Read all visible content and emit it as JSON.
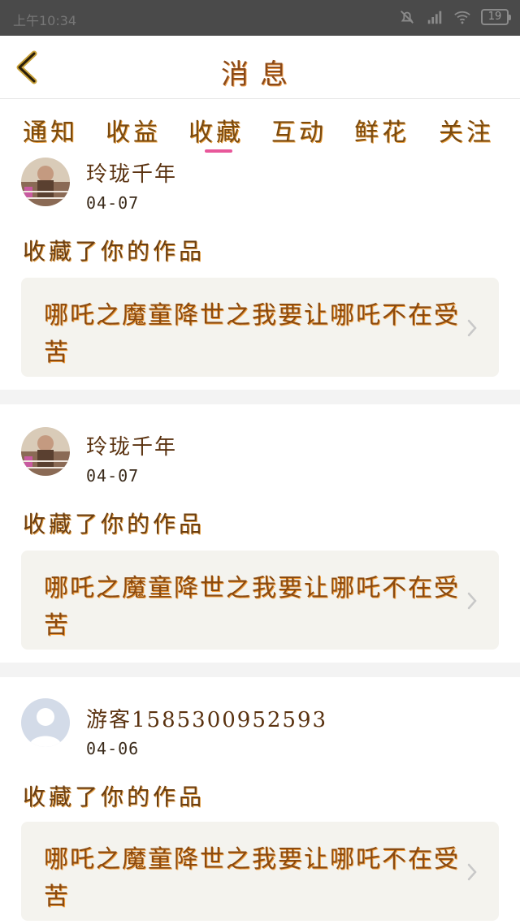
{
  "status_bar": {
    "time": "上午10:34",
    "battery": "19"
  },
  "header": {
    "title": "消息"
  },
  "tabs": [
    {
      "label": "通知"
    },
    {
      "label": "收益"
    },
    {
      "label": "收藏",
      "active": true
    },
    {
      "label": "互动"
    },
    {
      "label": "鲜花"
    },
    {
      "label": "关注"
    }
  ],
  "messages": [
    {
      "username": "玲珑千年",
      "date": "04-07",
      "action": "收藏了你的作品",
      "work_title": "哪吒之魔童降世之我要让哪吒不在受苦",
      "avatar": "photo-avatar"
    },
    {
      "username": "玲珑千年",
      "date": "04-07",
      "action": "收藏了你的作品",
      "work_title": "哪吒之魔童降世之我要让哪吒不在受苦",
      "avatar": "photo-avatar"
    },
    {
      "username": "游客1585300952593",
      "date": "04-06",
      "action": "收藏了你的作品",
      "work_title": "哪吒之魔童降世之我要让哪吒不在受苦",
      "avatar": "default-avatar"
    }
  ],
  "colors": {
    "accent": "#e8579a",
    "card_background": "#f4f3ee",
    "text": "#7a4a10"
  }
}
